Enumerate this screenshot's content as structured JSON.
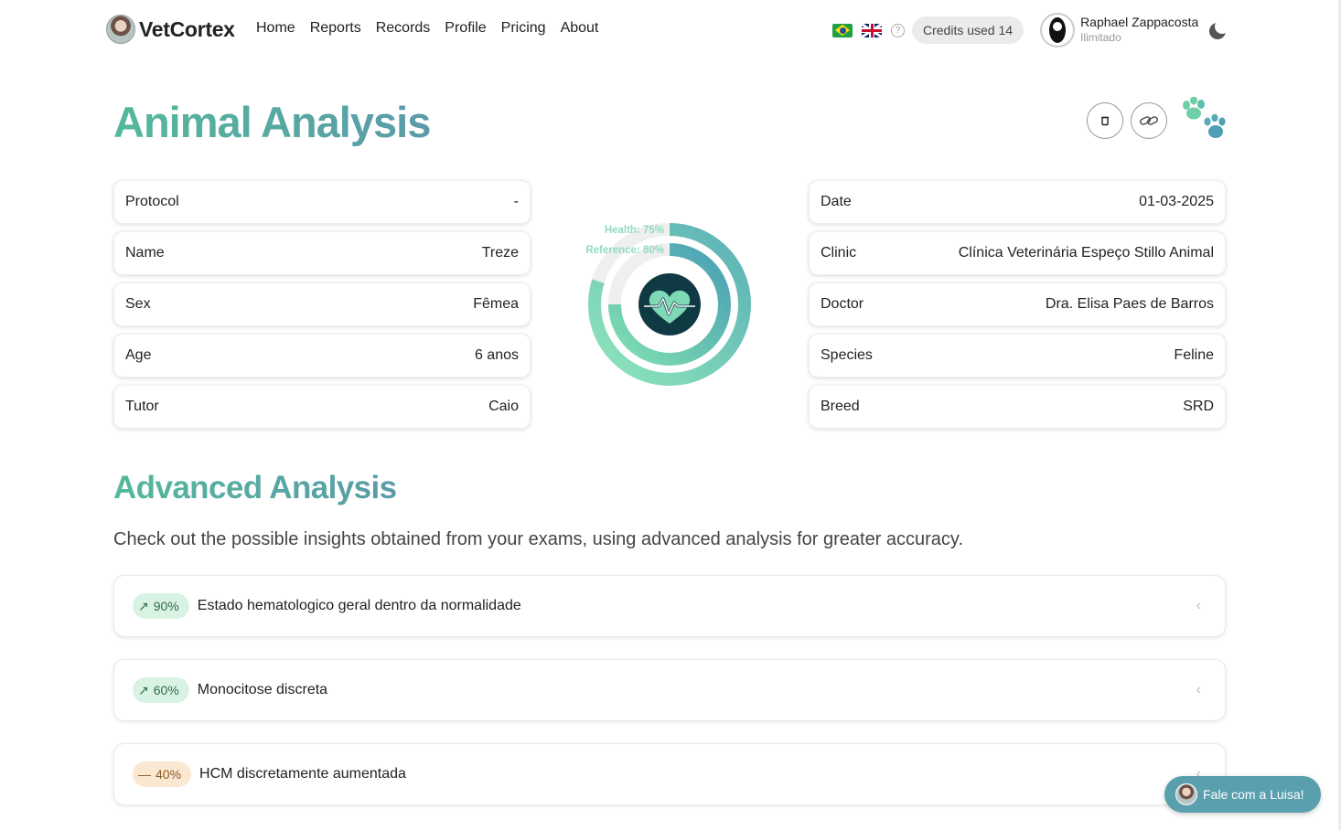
{
  "brand": {
    "name": "VetCortex"
  },
  "nav": {
    "items": [
      "Home",
      "Reports",
      "Records",
      "Profile",
      "Pricing",
      "About"
    ]
  },
  "header": {
    "credits_label": "Credits used 14",
    "user_name": "Raphael Zappacosta",
    "user_plan": "Ilimitado",
    "help_glyph": "?"
  },
  "page": {
    "title": "Animal Analysis"
  },
  "left_fields": [
    {
      "label": "Protocol",
      "value": "-"
    },
    {
      "label": "Name",
      "value": "Treze"
    },
    {
      "label": "Sex",
      "value": "Fêmea"
    },
    {
      "label": "Age",
      "value": "6 anos"
    },
    {
      "label": "Tutor",
      "value": "Caio"
    }
  ],
  "right_fields": [
    {
      "label": "Date",
      "value": "01-03-2025"
    },
    {
      "label": "Clinic",
      "value": "Clínica Veterinária Espeço Stillo Animal"
    },
    {
      "label": "Doctor",
      "value": "Dra. Elisa Paes de Barros"
    },
    {
      "label": "Species",
      "value": "Feline"
    },
    {
      "label": "Breed",
      "value": "SRD"
    }
  ],
  "gauge": {
    "health_label": "Health: 75%",
    "reference_label": "Reference: 80%",
    "health": 0.75,
    "reference": 0.8,
    "colors": {
      "start": "#7fe0b0",
      "end": "#4a9fb5",
      "track": "#efefef",
      "center": "#0f3a44"
    }
  },
  "advanced": {
    "title": "Advanced Analysis",
    "description": "Check out the possible insights obtained from your exams, using advanced analysis for greater accuracy.",
    "insights": [
      {
        "percent": "90%",
        "text": "Estado hematologico geral dentro da normalidade",
        "trend": "up"
      },
      {
        "percent": "60%",
        "text": "Monocitose discreta",
        "trend": "up"
      },
      {
        "percent": "40%",
        "text": "HCM discretamente aumentada",
        "trend": "flat"
      }
    ]
  },
  "chat": {
    "label": "Fale com a Luisa!"
  },
  "icons": {
    "delete": "trash-icon",
    "link": "link-icon",
    "paw": "paw-icon",
    "theme": "moon-icon",
    "chevron": "chevron-left-icon",
    "chevron_glyph": "‹",
    "trend_up_glyph": "↗",
    "trend_flat_glyph": "—"
  }
}
